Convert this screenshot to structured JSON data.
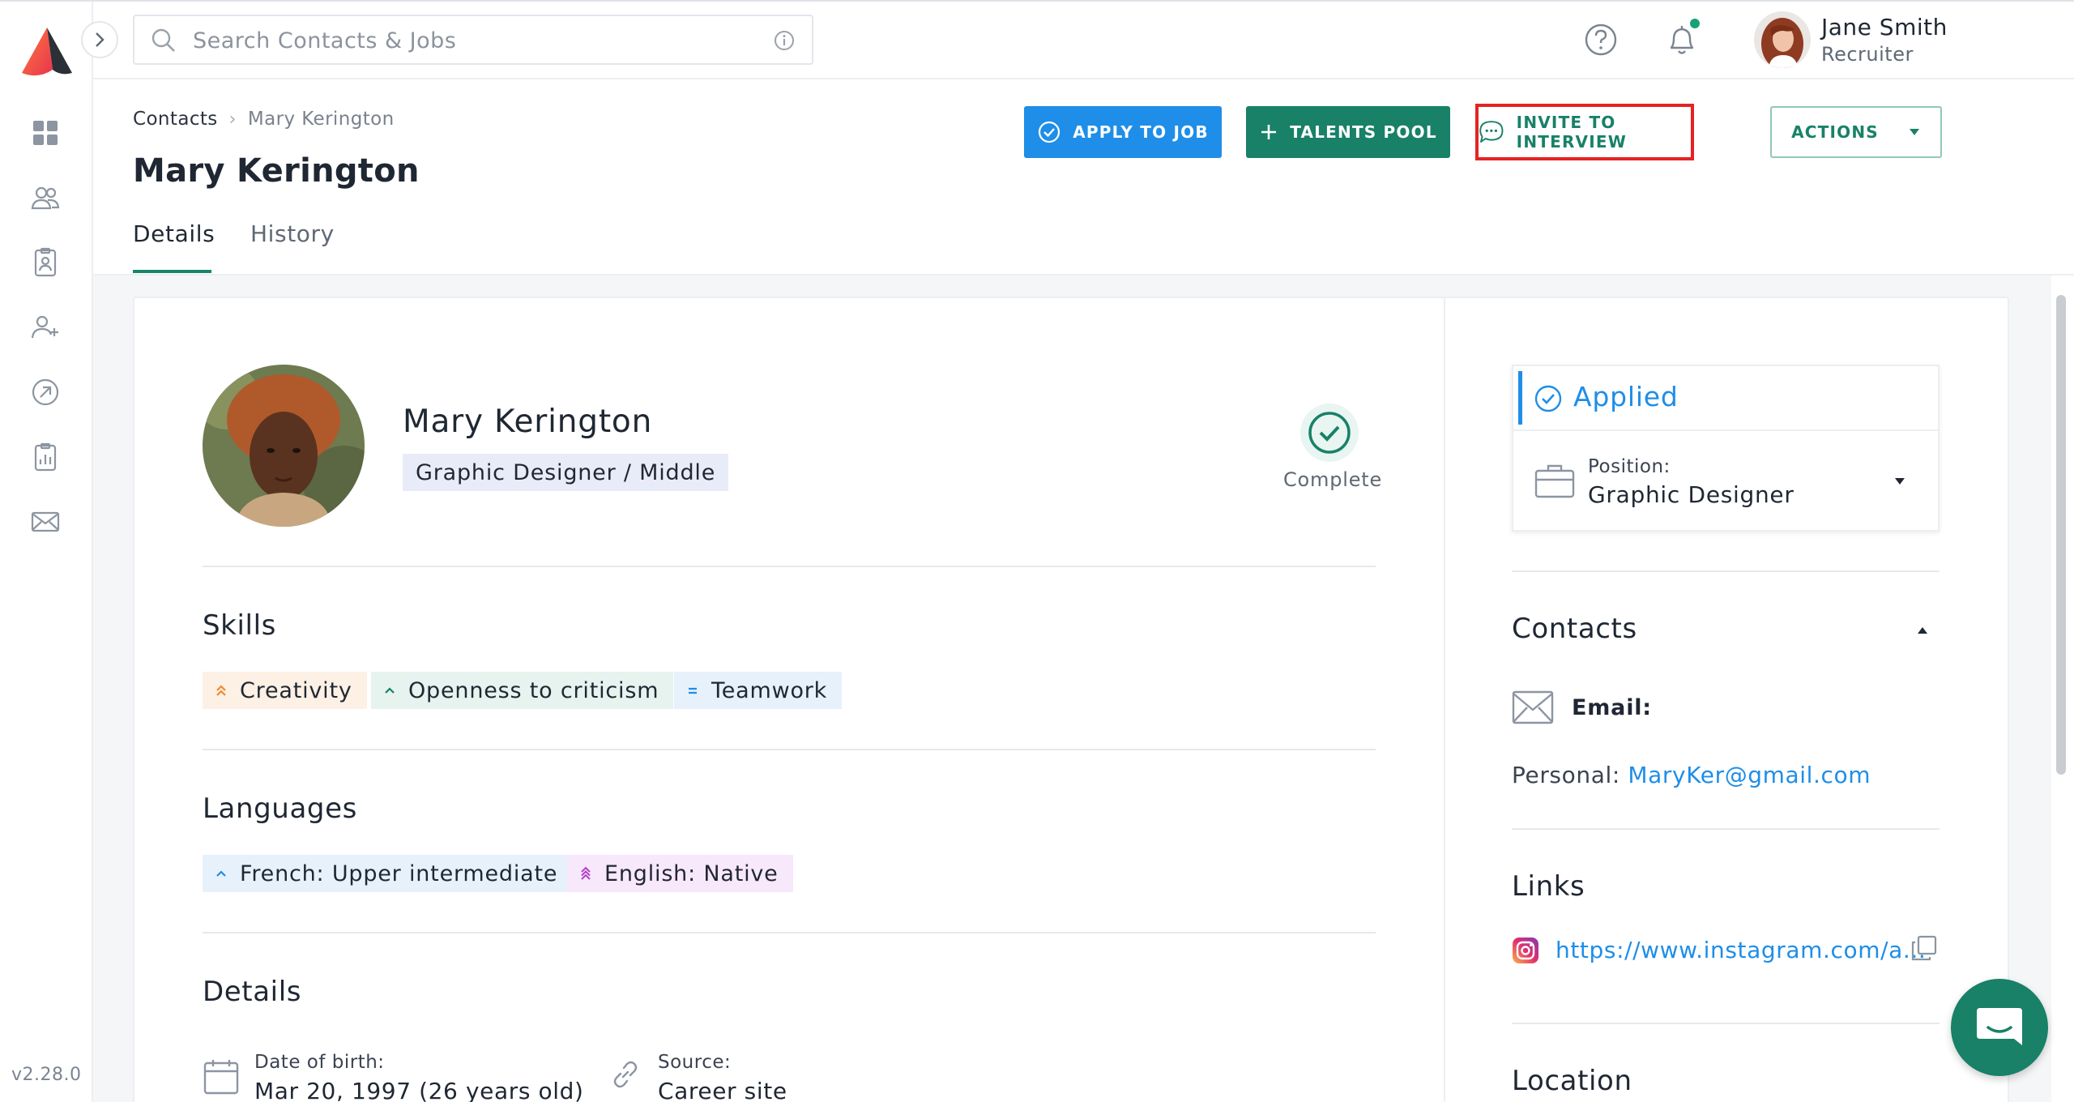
{
  "app": {
    "version": "v2.28.0",
    "brand_colors": {
      "accent_blue": "#1e8ee8",
      "accent_green": "#188168",
      "highlight_red": "#e52323"
    }
  },
  "sidebar": {
    "items": [
      {
        "icon": "dashboard-icon"
      },
      {
        "icon": "contacts-icon"
      },
      {
        "icon": "candidate-card-icon"
      },
      {
        "icon": "add-user-icon"
      },
      {
        "icon": "compass-icon"
      },
      {
        "icon": "reports-icon"
      },
      {
        "icon": "mail-icon"
      }
    ]
  },
  "topbar": {
    "search_placeholder": "Search Contacts & Jobs",
    "user": {
      "name": "Jane Smith",
      "role": "Recruiter"
    }
  },
  "breadcrumb": {
    "root": "Contacts",
    "current": "Mary Kerington"
  },
  "page": {
    "title": "Mary Kerington",
    "tabs": [
      {
        "label": "Details"
      },
      {
        "label": "History"
      }
    ],
    "actions": {
      "apply": "APPLY TO JOB",
      "talents": "TALENTS POOL",
      "invite": "INVITE TO INTERVIEW",
      "more": "ACTIONS"
    }
  },
  "profile": {
    "name": "Mary Kerington",
    "role": "Graphic Designer / Middle",
    "completeness": "Complete"
  },
  "skills": {
    "title": "Skills",
    "items": [
      {
        "label": "Creativity",
        "level": "high"
      },
      {
        "label": "Openness to criticism",
        "level": "medium"
      },
      {
        "label": "Teamwork",
        "level": "normal"
      }
    ]
  },
  "languages": {
    "title": "Languages",
    "items": [
      {
        "label": "French: Upper intermediate"
      },
      {
        "label": "English: Native"
      }
    ]
  },
  "details": {
    "title": "Details",
    "dob_label": "Date of birth:",
    "dob_value": "Mar 20, 1997 (26 years old)",
    "source_label": "Source:",
    "source_value": "Career site"
  },
  "status": {
    "label": "Applied",
    "position_label": "Position:",
    "position_value": "Graphic Designer"
  },
  "contacts": {
    "title": "Contacts",
    "email_label": "Email:",
    "personal_label": "Personal:",
    "personal_email": "MaryKer@gmail.com"
  },
  "links": {
    "title": "Links",
    "instagram": "https://www.instagram.com/a..."
  },
  "location": {
    "title": "Location"
  }
}
